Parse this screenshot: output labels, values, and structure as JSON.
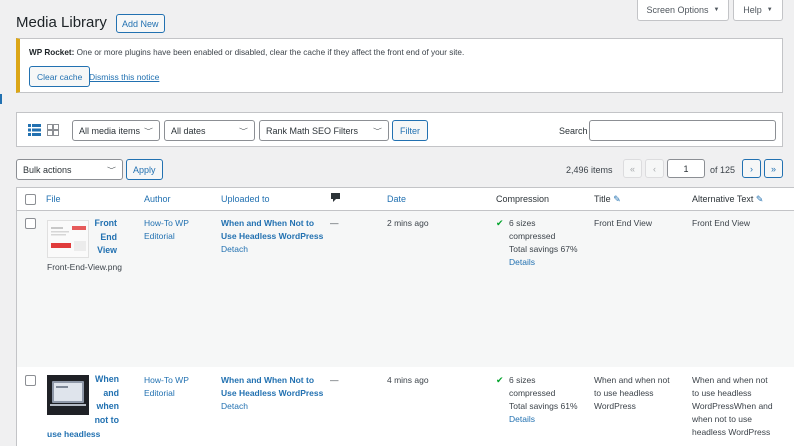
{
  "header": {
    "title": "Media Library",
    "add_new": "Add New",
    "screen_options": "Screen Options",
    "help": "Help"
  },
  "notice": {
    "label": "WP Rocket:",
    "message": "One or more plugins have been enabled or disabled, clear the cache if they affect the front end of your site.",
    "clear_cache": "Clear cache",
    "dismiss": "Dismiss this notice",
    "accent_color": "#dba617"
  },
  "filters": {
    "media_type": "All media items",
    "dates": "All dates",
    "seo": "Rank Math SEO Filters",
    "filter_button": "Filter",
    "search_label": "Search",
    "search_value": ""
  },
  "bulk": {
    "bulk_actions": "Bulk actions",
    "apply": "Apply"
  },
  "pagination": {
    "items": "2,496 items",
    "first": "«",
    "prev": "‹",
    "current_page": "1",
    "of_pages": "of 125",
    "next": "›",
    "last": "»"
  },
  "columns": {
    "file": "File",
    "author": "Author",
    "uploaded_to": "Uploaded to",
    "comments_icon": "comment-bubble-icon",
    "date": "Date",
    "compression": "Compression",
    "title": "Title",
    "alt_text": "Alternative Text"
  },
  "rows": [
    {
      "title_lines": [
        "Front",
        "End",
        "View"
      ],
      "filename": "Front-End-View.png",
      "author_lines": [
        "How-To WP",
        "Editorial"
      ],
      "uploaded_lines": [
        "When and When Not to",
        "Use Headless WordPress"
      ],
      "detach": "Detach",
      "comments": "—",
      "date": "2 mins ago",
      "comp_lines": [
        "6 sizes",
        "compressed",
        "Total savings 67%"
      ],
      "details": "Details",
      "title": "Front End View",
      "alt": "Front End View"
    },
    {
      "title_lines": [
        "When",
        "and",
        "when",
        "not to"
      ],
      "filename": "use headless",
      "author_lines": [
        "How-To WP",
        "Editorial"
      ],
      "uploaded_lines": [
        "When and When Not to",
        "Use Headless WordPress"
      ],
      "detach": "Detach",
      "comments": "—",
      "date": "4 mins ago",
      "comp_lines": [
        "6 sizes",
        "compressed",
        "Total savings 61%"
      ],
      "details": "Details",
      "title_lines_col": [
        "When and when not",
        "to use headless",
        "WordPress"
      ],
      "alt_lines": [
        "When and when not",
        "to use headless",
        "WordPressWhen and",
        "when not to use",
        "headless WordPress"
      ]
    }
  ]
}
